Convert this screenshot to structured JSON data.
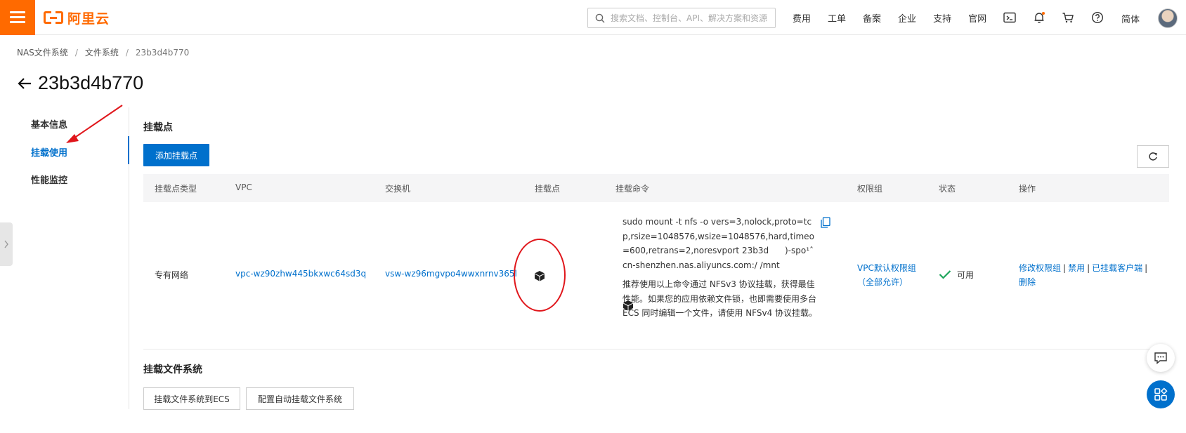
{
  "header": {
    "logo_text": "阿里云",
    "search_placeholder": "搜索文档、控制台、API、解决方案和资源",
    "nav": [
      "费用",
      "工单",
      "备案",
      "企业",
      "支持",
      "官网"
    ],
    "language": "简体",
    "icons": [
      "menu-icon",
      "terminal-icon",
      "bell-icon",
      "cart-icon",
      "help-icon"
    ],
    "accent_color": "#ff6a00"
  },
  "breadcrumb": [
    "NAS文件系统",
    "文件系统",
    "23b3d4b770"
  ],
  "page": {
    "title": "23b3d4b770"
  },
  "sidebar": {
    "items": [
      {
        "label": "基本信息",
        "active": false
      },
      {
        "label": "挂载使用",
        "active": true
      },
      {
        "label": "性能监控",
        "active": false
      }
    ]
  },
  "mount_points": {
    "section_title": "挂载点",
    "add_button": "添加挂载点",
    "columns": [
      "挂载点类型",
      "VPC",
      "交换机",
      "挂载点",
      "挂载命令",
      "权限组",
      "状态",
      "操作"
    ],
    "rows": [
      {
        "type": "专有网络",
        "vpc": "vpc-wz90zhw445bkxwc64sd3q",
        "vswitch": "vsw-wz96mgvpo4wwxnrnv365l",
        "mount_command": "sudo mount -t nfs -o vers=3,nolock,proto=tcp,rsize=1048576,wsize=1048576,hard,timeo=600,retrans=2,noresvport 23b3d      )-spo¹ˆ cn-shenzhen.nas.aliyuncs.com:/ /mnt",
        "mount_note": "推荐使用以上命令通过 NFSv3 协议挂载，获得最佳性能。如果您的应用依赖文件锁，也即需要使用多台 ECS 同时编辑一个文件，请使用 NFSv4 协议挂载。",
        "permission_group": "VPC默认权限组",
        "permission_group_sub": "（全部允许）",
        "status": "可用",
        "actions": [
          "修改权限组",
          "禁用",
          "已挂载客户端",
          "删除"
        ]
      }
    ]
  },
  "mount_fs": {
    "section_title": "挂载文件系统",
    "buttons": [
      "挂载文件系统到ECS",
      "配置自动挂载文件系统"
    ]
  },
  "brand_blue": "#0070cc"
}
